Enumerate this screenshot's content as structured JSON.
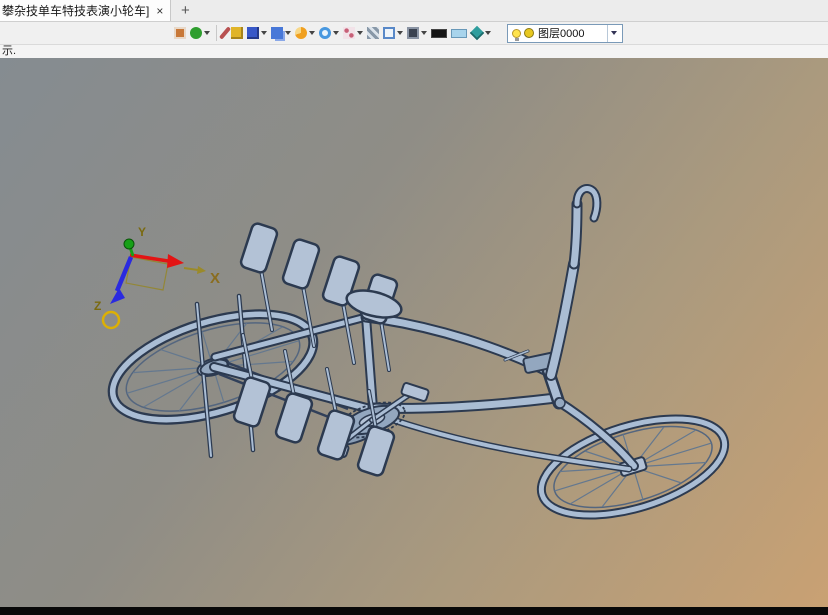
{
  "tab_bar": {
    "active_tab": {
      "title": "攀杂技单车特技表演小轮车]",
      "close": "×"
    },
    "new_tab": "+"
  },
  "toolbar": {
    "icons": [
      {
        "name": "clipboard-icon",
        "color": "#c87838",
        "caret": false
      },
      {
        "name": "material-ball-icon",
        "color": "#2f9e2f",
        "caret": true
      },
      {
        "name": "pen-icon",
        "color": "#b85050",
        "caret": false
      },
      {
        "name": "yellow-cube-icon",
        "color": "#e0b428",
        "caret": false
      },
      {
        "name": "blue-cube-icon",
        "color": "#3858c8",
        "caret": true
      },
      {
        "name": "assembly-boxes-icon",
        "color": "#4878d8",
        "caret": true
      },
      {
        "name": "pie-view-icon",
        "color": "#f0a020",
        "caret": true
      },
      {
        "name": "zoom-icon",
        "color": "#4898e0",
        "caret": true
      },
      {
        "name": "stipple-icon",
        "color": "#c86078",
        "caret": true
      },
      {
        "name": "texture-icon",
        "color": "#8898a8",
        "caret": false
      },
      {
        "name": "dimension-icon",
        "color": "#5888c8",
        "caret": true
      },
      {
        "name": "display-mode-icon",
        "color": "#3a4250",
        "caret": true
      },
      {
        "name": "black-swatch-icon",
        "color": "#151515",
        "caret": false
      },
      {
        "name": "blue-swatch-icon",
        "color": "#a8d4ec",
        "caret": false
      },
      {
        "name": "shaded-view-icon",
        "color": "#2f9e9e",
        "caret": true
      }
    ],
    "layer_combo": {
      "label": "图层0000",
      "swatch_color": "#e8c820"
    }
  },
  "prompt": {
    "text": "示."
  },
  "viewport": {
    "axis_labels": {
      "x": "X",
      "y": "Y",
      "z": "Z"
    },
    "colors": {
      "x_axis": "#e31414",
      "y_axis": "#17a017",
      "z_axis": "#2a2ae0",
      "highlight_ring": "#dcb004",
      "model_fill": "#b3c2d6",
      "model_outline": "#2c3a50",
      "bg_top_left": "#858c91",
      "bg_bottom_right": "#c9a173"
    }
  }
}
